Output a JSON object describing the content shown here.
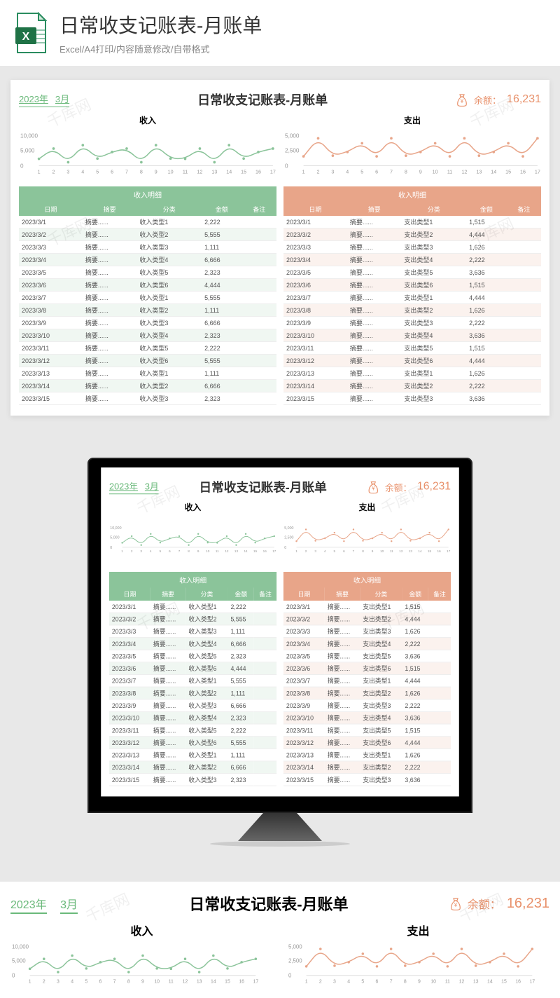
{
  "banner": {
    "title": "日常收支记账表-月账单",
    "subtitle": "Excel/A4打印/内容随意修改/自带格式"
  },
  "sheet": {
    "year": "2023年",
    "month": "3月",
    "title": "日常收支记账表-月账单",
    "balance_label": "余额：",
    "balance_value": "16,231"
  },
  "watermark": "千库网",
  "income_chart": {
    "title": "收入",
    "ymax_label": "10,000",
    "ymid_label": "5,000",
    "ymin_label": "0"
  },
  "expense_chart": {
    "title": "支出",
    "ymax_label": "5,000",
    "ymid_label": "2,500",
    "ymin_label": "0"
  },
  "income_table": {
    "title": "收入明细",
    "headers": [
      "日期",
      "摘要",
      "分类",
      "金额",
      "备注"
    ],
    "rows": [
      [
        "2023/3/1",
        "摘要......",
        "收入类型1",
        "2,222",
        ""
      ],
      [
        "2023/3/2",
        "摘要......",
        "收入类型2",
        "5,555",
        ""
      ],
      [
        "2023/3/3",
        "摘要......",
        "收入类型3",
        "1,111",
        ""
      ],
      [
        "2023/3/4",
        "摘要......",
        "收入类型4",
        "6,666",
        ""
      ],
      [
        "2023/3/5",
        "摘要......",
        "收入类型5",
        "2,323",
        ""
      ],
      [
        "2023/3/6",
        "摘要......",
        "收入类型6",
        "4,444",
        ""
      ],
      [
        "2023/3/7",
        "摘要......",
        "收入类型1",
        "5,555",
        ""
      ],
      [
        "2023/3/8",
        "摘要......",
        "收入类型2",
        "1,111",
        ""
      ],
      [
        "2023/3/9",
        "摘要......",
        "收入类型3",
        "6,666",
        ""
      ],
      [
        "2023/3/10",
        "摘要......",
        "收入类型4",
        "2,323",
        ""
      ],
      [
        "2023/3/11",
        "摘要......",
        "收入类型5",
        "2,222",
        ""
      ],
      [
        "2023/3/12",
        "摘要......",
        "收入类型6",
        "5,555",
        ""
      ],
      [
        "2023/3/13",
        "摘要......",
        "收入类型1",
        "1,111",
        ""
      ],
      [
        "2023/3/14",
        "摘要......",
        "收入类型2",
        "6,666",
        ""
      ],
      [
        "2023/3/15",
        "摘要......",
        "收入类型3",
        "2,323",
        ""
      ]
    ]
  },
  "expense_table": {
    "title": "收入明细",
    "headers": [
      "日期",
      "摘要",
      "分类",
      "金额",
      "备注"
    ],
    "rows": [
      [
        "2023/3/1",
        "摘要......",
        "支出类型1",
        "1,515",
        ""
      ],
      [
        "2023/3/2",
        "摘要......",
        "支出类型2",
        "4,444",
        ""
      ],
      [
        "2023/3/3",
        "摘要......",
        "支出类型3",
        "1,626",
        ""
      ],
      [
        "2023/3/4",
        "摘要......",
        "支出类型4",
        "2,222",
        ""
      ],
      [
        "2023/3/5",
        "摘要......",
        "支出类型5",
        "3,636",
        ""
      ],
      [
        "2023/3/6",
        "摘要......",
        "支出类型6",
        "1,515",
        ""
      ],
      [
        "2023/3/7",
        "摘要......",
        "支出类型1",
        "4,444",
        ""
      ],
      [
        "2023/3/8",
        "摘要......",
        "支出类型2",
        "1,626",
        ""
      ],
      [
        "2023/3/9",
        "摘要......",
        "支出类型3",
        "2,222",
        ""
      ],
      [
        "2023/3/10",
        "摘要......",
        "支出类型4",
        "3,636",
        ""
      ],
      [
        "2023/3/11",
        "摘要......",
        "支出类型5",
        "1,515",
        ""
      ],
      [
        "2023/3/12",
        "摘要......",
        "支出类型6",
        "4,444",
        ""
      ],
      [
        "2023/3/13",
        "摘要......",
        "支出类型1",
        "1,626",
        ""
      ],
      [
        "2023/3/14",
        "摘要......",
        "支出类型2",
        "2,222",
        ""
      ],
      [
        "2023/3/15",
        "摘要......",
        "支出类型3",
        "3,636",
        ""
      ]
    ]
  },
  "chart_data": [
    {
      "type": "line",
      "title": "收入",
      "xlabel": "",
      "ylabel": "",
      "ylim": [
        0,
        10000
      ],
      "categories": [
        1,
        2,
        3,
        4,
        5,
        6,
        7,
        8,
        9,
        10,
        11,
        12,
        13,
        14,
        15,
        16,
        17
      ],
      "values": [
        2222,
        5555,
        1111,
        6666,
        2323,
        4444,
        5555,
        1111,
        6666,
        2323,
        2222,
        5555,
        1111,
        6666,
        2323,
        4444,
        5555
      ]
    },
    {
      "type": "line",
      "title": "支出",
      "xlabel": "",
      "ylabel": "",
      "ylim": [
        0,
        5000
      ],
      "categories": [
        1,
        2,
        3,
        4,
        5,
        6,
        7,
        8,
        9,
        10,
        11,
        12,
        13,
        14,
        15,
        16,
        17
      ],
      "values": [
        1515,
        4444,
        1626,
        2222,
        3636,
        1515,
        4444,
        1626,
        2222,
        3636,
        1515,
        4444,
        1626,
        2222,
        3636,
        1515,
        4444
      ]
    }
  ]
}
